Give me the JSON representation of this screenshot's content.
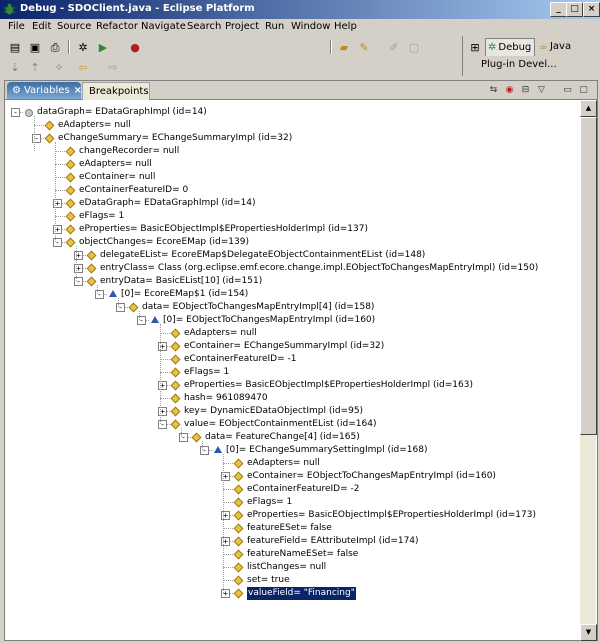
{
  "window": {
    "title": "Debug - SDOClient.java - Eclipse Platform",
    "controls": {
      "minimize": "_",
      "maximize": "□",
      "close": "×"
    }
  },
  "menu": [
    "File",
    "Edit",
    "Source",
    "Refactor",
    "Navigate",
    "Search",
    "Project",
    "Run",
    "Window",
    "Help"
  ],
  "perspectives": {
    "debug": "Debug",
    "java": "Java",
    "plugin": "Plug-in Devel..."
  },
  "views": {
    "variables_tab": "Variables",
    "variables_close": "×",
    "breakpoints_tab": "Breakpoints"
  },
  "tree": [
    {
      "label": "dataGraph= EDataGraphImpl  (id=14)",
      "expand": "-",
      "icon": "gray"
    },
    {
      "label": "eAdapters= null",
      "expand": "",
      "icon": "diamond"
    },
    {
      "label": "eChangeSummary= EChangeSummaryImpl  (id=32)",
      "expand": "-",
      "icon": "diamond"
    },
    {
      "label": "changeRecorder= null",
      "expand": "",
      "icon": "diamond"
    },
    {
      "label": "eAdapters= null",
      "expand": "",
      "icon": "diamond"
    },
    {
      "label": "eContainer= null",
      "expand": "",
      "icon": "diamond"
    },
    {
      "label": "eContainerFeatureID= 0",
      "expand": "",
      "icon": "diamond"
    },
    {
      "label": "eDataGraph= EDataGraphImpl  (id=14)",
      "expand": "+",
      "icon": "diamond"
    },
    {
      "label": "eFlags= 1",
      "expand": "",
      "icon": "diamond"
    },
    {
      "label": "eProperties= BasicEObjectImpl$EPropertiesHolderImpl  (id=137)",
      "expand": "+",
      "icon": "diamond"
    },
    {
      "label": "objectChanges= EcoreEMap  (id=139)",
      "expand": "-",
      "icon": "diamond"
    },
    {
      "label": "delegateEList= EcoreEMap$DelegateEObjectContainmentEList  (id=148)",
      "expand": "+",
      "icon": "diamond"
    },
    {
      "label": "entryClass= Class (org.eclipse.emf.ecore.change.impl.EObjectToChangesMapEntryImpl) (id=150)",
      "expand": "+",
      "icon": "diamond"
    },
    {
      "label": "entryData= BasicEList[10]  (id=151)",
      "expand": "-",
      "icon": "diamond"
    },
    {
      "label": "[0]= EcoreEMap$1  (id=154)",
      "expand": "-",
      "icon": "tri"
    },
    {
      "label": "data= EObjectToChangesMapEntryImpl[4]  (id=158)",
      "expand": "-",
      "icon": "diamond"
    },
    {
      "label": "[0]= EObjectToChangesMapEntryImpl  (id=160)",
      "expand": "-",
      "icon": "tri"
    },
    {
      "label": "eAdapters= null",
      "expand": "",
      "icon": "diamond"
    },
    {
      "label": "eContainer= EChangeSummaryImpl  (id=32)",
      "expand": "+",
      "icon": "diamond"
    },
    {
      "label": "eContainerFeatureID= -1",
      "expand": "",
      "icon": "diamond"
    },
    {
      "label": "eFlags= 1",
      "expand": "",
      "icon": "diamond"
    },
    {
      "label": "eProperties= BasicEObjectImpl$EPropertiesHolderImpl  (id=163)",
      "expand": "+",
      "icon": "diamond"
    },
    {
      "label": "hash= 961089470",
      "expand": "",
      "icon": "diamond"
    },
    {
      "label": "key= DynamicEDataObjectImpl  (id=95)",
      "expand": "+",
      "icon": "diamond"
    },
    {
      "label": "value= EObjectContainmentEList  (id=164)",
      "expand": "-",
      "icon": "diamond"
    },
    {
      "label": "data= FeatureChange[4]  (id=165)",
      "expand": "-",
      "icon": "diamond"
    },
    {
      "label": "[0]= EChangeSummarySettingImpl  (id=168)",
      "expand": "-",
      "icon": "tri"
    },
    {
      "label": "eAdapters= null",
      "expand": "",
      "icon": "diamond"
    },
    {
      "label": "eContainer= EObjectToChangesMapEntryImpl  (id=160)",
      "expand": "+",
      "icon": "diamond"
    },
    {
      "label": "eContainerFeatureID= -2",
      "expand": "",
      "icon": "diamond"
    },
    {
      "label": "eFlags= 1",
      "expand": "",
      "icon": "diamond"
    },
    {
      "label": "eProperties= BasicEObjectImpl$EPropertiesHolderImpl  (id=173)",
      "expand": "+",
      "icon": "diamond"
    },
    {
      "label": "featureESet= false",
      "expand": "",
      "icon": "diamond"
    },
    {
      "label": "featureField= EAttributeImpl  (id=174)",
      "expand": "+",
      "icon": "diamond"
    },
    {
      "label": "featureNameESet= false",
      "expand": "",
      "icon": "diamond"
    },
    {
      "label": "listChanges= null",
      "expand": "",
      "icon": "diamond"
    },
    {
      "label": "set= true",
      "expand": "",
      "icon": "diamond"
    },
    {
      "label": "valueField= \"Financing\"",
      "expand": "+",
      "icon": "diamond",
      "selected": true
    }
  ],
  "colors": {
    "selection": "#0a246a",
    "titlebar_start": "#0a246a",
    "titlebar_end": "#a6caf0",
    "variable_icon": "#e8c34a"
  }
}
